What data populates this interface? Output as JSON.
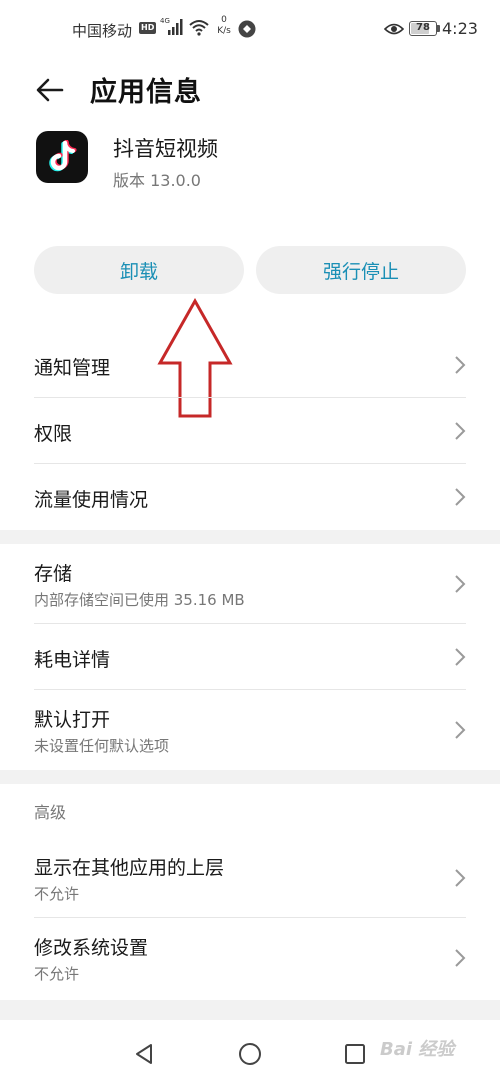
{
  "status_bar": {
    "carrier": "中国移动",
    "hd": "HD",
    "network": "4G",
    "speed_value": "0",
    "speed_unit": "K/s",
    "battery": "78",
    "time": "4:23"
  },
  "header": {
    "title": "应用信息",
    "back_icon": "arrow-left-icon"
  },
  "app": {
    "name": "抖音短视频",
    "version": "版本 13.0.0",
    "icon": "tiktok-logo-icon"
  },
  "actions": {
    "uninstall_label": "卸载",
    "force_stop_label": "强行停止",
    "accent_color": "#1a8fb5"
  },
  "annotation": {
    "arrow_color": "#c62828"
  },
  "section1": {
    "items": [
      {
        "title": "通知管理"
      },
      {
        "title": "权限"
      },
      {
        "title": "流量使用情况"
      }
    ]
  },
  "section2": {
    "items": [
      {
        "title": "存储",
        "subtitle": "内部存储空间已使用 35.16 MB"
      },
      {
        "title": "耗电详情"
      },
      {
        "title": "默认打开",
        "subtitle": "未设置任何默认选项"
      }
    ]
  },
  "section3": {
    "header": "高级",
    "items": [
      {
        "title": "显示在其他应用的上层",
        "subtitle": "不允许"
      },
      {
        "title": "修改系统设置",
        "subtitle": "不允许"
      }
    ]
  },
  "nav_bar": {
    "back_icon": "triangle-back-icon",
    "home_icon": "circle-home-icon",
    "recent_icon": "square-recent-icon"
  },
  "watermark": "Bai 经验"
}
